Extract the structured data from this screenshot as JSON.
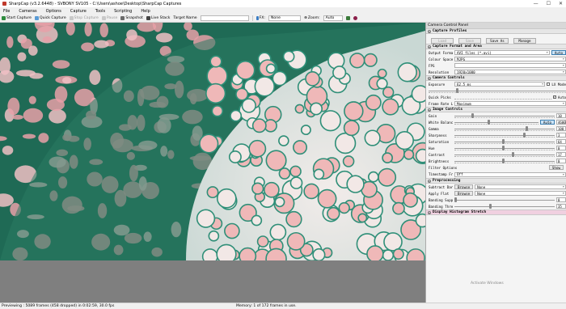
{
  "window": {
    "title": "SharpCap (v3.2.6448) - SVBONY SV105 - C:\\Users\\ashoe\\Desktop\\SharpCap Captures",
    "minimize": "—",
    "maximize": "☐",
    "close": "✕"
  },
  "menu": [
    "File",
    "Cameras",
    "Options",
    "Capture",
    "Tools",
    "Scripting",
    "Help"
  ],
  "toolbar": {
    "start_capture": "Start Capture",
    "quick_capture": "Quick Capture",
    "stop_capture": "Stop Capture",
    "pause": "Pause",
    "snapshot": "Snapshot",
    "live_stack": "Live Stack",
    "target_name_label": "Target Name",
    "target_name_value": "",
    "fx_label": "FX:",
    "fx_value": "None",
    "zoom_label": "Zoom:",
    "zoom_value": "Auto"
  },
  "panel": {
    "title": "Camera Control Panel",
    "capture_profiles": {
      "header": "Capture Profiles",
      "buttons": [
        "Load",
        "Save",
        "Save As",
        "Manage"
      ]
    },
    "capture_format": {
      "header": "Capture Format and Area",
      "output_format_label": "Output Format",
      "output_format_value": "AVI files (*.avi)",
      "output_format_btn": "Auto",
      "colour_space_label": "Colour Space",
      "colour_space_value": "MJPG",
      "fps_label": "FPS",
      "fps_value": "",
      "resolution_label": "Resolution",
      "resolution_value": "1920x1080"
    },
    "camera_controls": {
      "header": "Camera Controls",
      "exposure_label": "Exposure",
      "exposure_value": "62.5 ms",
      "lx_mode_label": "LX Mode",
      "quick_picks_label": "Quick Picks",
      "auto_label": "Auto",
      "frame_rate_label": "Frame Rate Limit",
      "frame_rate_value": "Maximum"
    },
    "image_controls": {
      "header": "Image Controls",
      "sliders": [
        {
          "label": "Gain",
          "value": "10",
          "pos": 0.18
        },
        {
          "label": "White Balance",
          "value": "4600",
          "pos": 0.42,
          "auto": "Auto"
        },
        {
          "label": "Gamma",
          "value": "100",
          "pos": 0.75
        },
        {
          "label": "Sharpness",
          "value": "3",
          "pos": 0.72
        },
        {
          "label": "Saturation",
          "value": "64",
          "pos": 0.5
        },
        {
          "label": "Hue",
          "value": "0",
          "pos": 0.5
        },
        {
          "label": "Contrast",
          "value": "17",
          "pos": 0.6
        },
        {
          "label": "Brightness",
          "value": "0",
          "pos": 0.5
        }
      ],
      "filter_options_label": "Filter Options",
      "filter_options_btn": "Show",
      "timestamp_label": "Timestamp Frames",
      "timestamp_value": "Off"
    },
    "preprocessing": {
      "header": "Preprocessing",
      "subtract_dark_label": "Subtract Dark",
      "subtract_dark_btn": "Browse",
      "subtract_dark_value": "None",
      "apply_flat_label": "Apply Flat",
      "apply_flat_btn": "Browse",
      "apply_flat_value": "None",
      "banding_supp_label": "Banding Suppression",
      "banding_supp_value": "0",
      "banding_thresh_label": "Banding Threshold",
      "banding_thresh_value": "35"
    },
    "histogram": {
      "header": "Display Histogram Stretch"
    }
  },
  "status": {
    "left": "Previewing : 5089 frames (458 dropped) in 0:02:59, 30.0 fps",
    "right": "Memory: 1 of 172 frames in use."
  },
  "watermark": "Activate Windows"
}
